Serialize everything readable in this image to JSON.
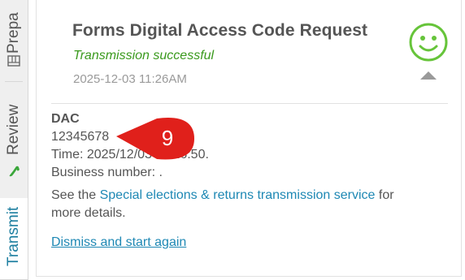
{
  "sidebar": {
    "tabs": [
      {
        "label": "Prepa",
        "icon": "spreadsheet-icon"
      },
      {
        "label": "Review",
        "icon": "checkmark-icon"
      },
      {
        "label": "Transmit",
        "active": true
      }
    ]
  },
  "header": {
    "title": "Forms Digital Access Code Request",
    "status": "Transmission successful",
    "timestamp": "2025-12-03 11:26AM",
    "status_icon": "smiley-icon",
    "collapse_icon": "chevron-up-icon"
  },
  "details": {
    "dac_label": "DAC",
    "dac_value": "12345678",
    "time_text": "Time: 2025/12/03 11:26:50.",
    "business_number_text": "Business number: .",
    "see_text": "See the",
    "link_text": "Special elections & returns transmission service",
    "for_text": "for",
    "more_text": "more details.",
    "dismiss_text": "Dismiss and start again"
  },
  "callout": {
    "number": "9"
  },
  "colors": {
    "success": "#3b9a1e",
    "link": "#1e88b4",
    "callout": "#e0201b",
    "smiley": "#66c43a"
  }
}
